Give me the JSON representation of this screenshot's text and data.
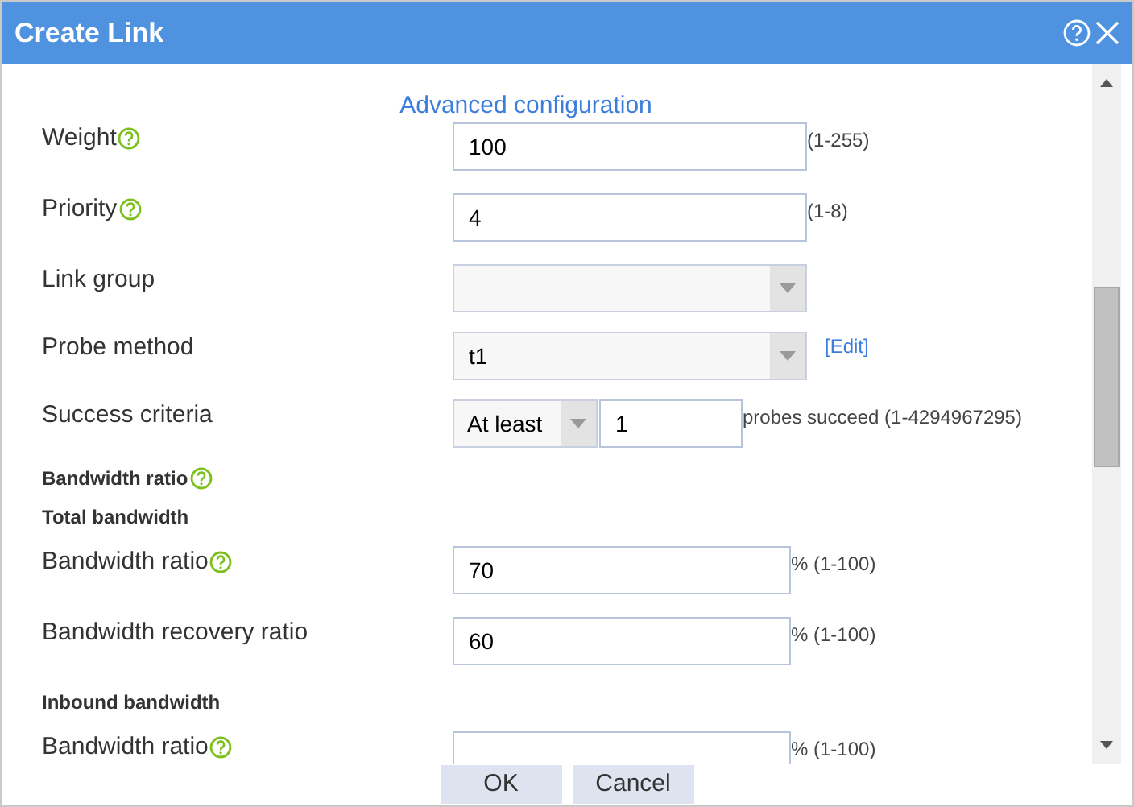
{
  "window": {
    "title": "Create Link"
  },
  "advanced_link": "Advanced configuration",
  "rows": [
    {
      "kind": "input",
      "label": "Weight",
      "help": true,
      "value": "100",
      "hint": "(1-255)"
    },
    {
      "kind": "input",
      "label": "Priority",
      "help": true,
      "value": "4",
      "hint": "(1-8)"
    },
    {
      "kind": "select",
      "label": "Link group",
      "help": false
    },
    {
      "kind": "select",
      "label": "Probe method",
      "help": false,
      "value": "t1",
      "link": "[Edit]"
    },
    {
      "kind": "criteria",
      "label": "Success criteria",
      "help": false,
      "option": "At least",
      "value": "1",
      "hint": "probes succeed (1-4294967295)"
    },
    {
      "kind": "heading",
      "label": "Bandwidth ratio",
      "help": true
    },
    {
      "kind": "subheading",
      "label": "Total bandwidth",
      "help": false
    },
    {
      "kind": "input_short",
      "label": "Bandwidth ratio",
      "help": true,
      "value": "70",
      "hint": "% (1-100)"
    },
    {
      "kind": "input_short",
      "label": "Bandwidth recovery ratio",
      "help": false,
      "value": "60",
      "hint": "% (1-100)"
    },
    {
      "kind": "subheading",
      "label": "Inbound bandwidth",
      "help": false
    },
    {
      "kind": "input_short",
      "label": "Bandwidth ratio",
      "help": true,
      "hint": "% (1-100)"
    }
  ],
  "buttons": [
    "OK",
    "Cancel"
  ]
}
